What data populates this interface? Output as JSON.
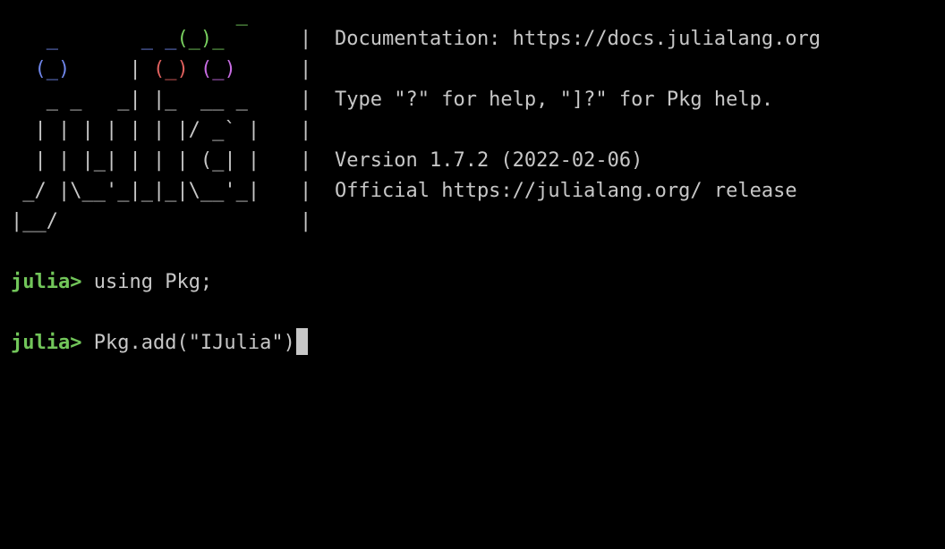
{
  "logo": {
    "row0": "                   _",
    "row1a": "   _       _ _",
    "row1g": "(_)",
    "row1b": "_",
    "row2a": "  ",
    "row2b": "(_)",
    "row2c": "     | ",
    "row2d": "(_)",
    "row2e": " ",
    "row2f": "(_)",
    "row3": "   _ _   _| |_  __ _",
    "row4": "  | | | | | | |/ _` |",
    "row5": "  | | |_| | | | (_| |",
    "row6": " _/ |\\__'_|_|_|\\__'_|",
    "row7": "|__/",
    "pipe": "|"
  },
  "banner": {
    "documentation": "Documentation: https://docs.julialang.org",
    "help": "Type \"?\" for help, \"]?\" for Pkg help.",
    "version": "Version 1.7.2 (2022-02-06)",
    "release": "Official https://julialang.org/ release"
  },
  "session": {
    "prompt": "julia>",
    "command1": " using Pkg;",
    "command2": " Pkg.add(\"IJulia\")"
  },
  "colors": {
    "prompt": "#72c65a",
    "text": "#c7c7c7",
    "background": "#000000",
    "logo_blue": "#6f86ea",
    "logo_red": "#e0615e",
    "logo_green": "#79d05f",
    "logo_purple": "#c86ce3"
  }
}
